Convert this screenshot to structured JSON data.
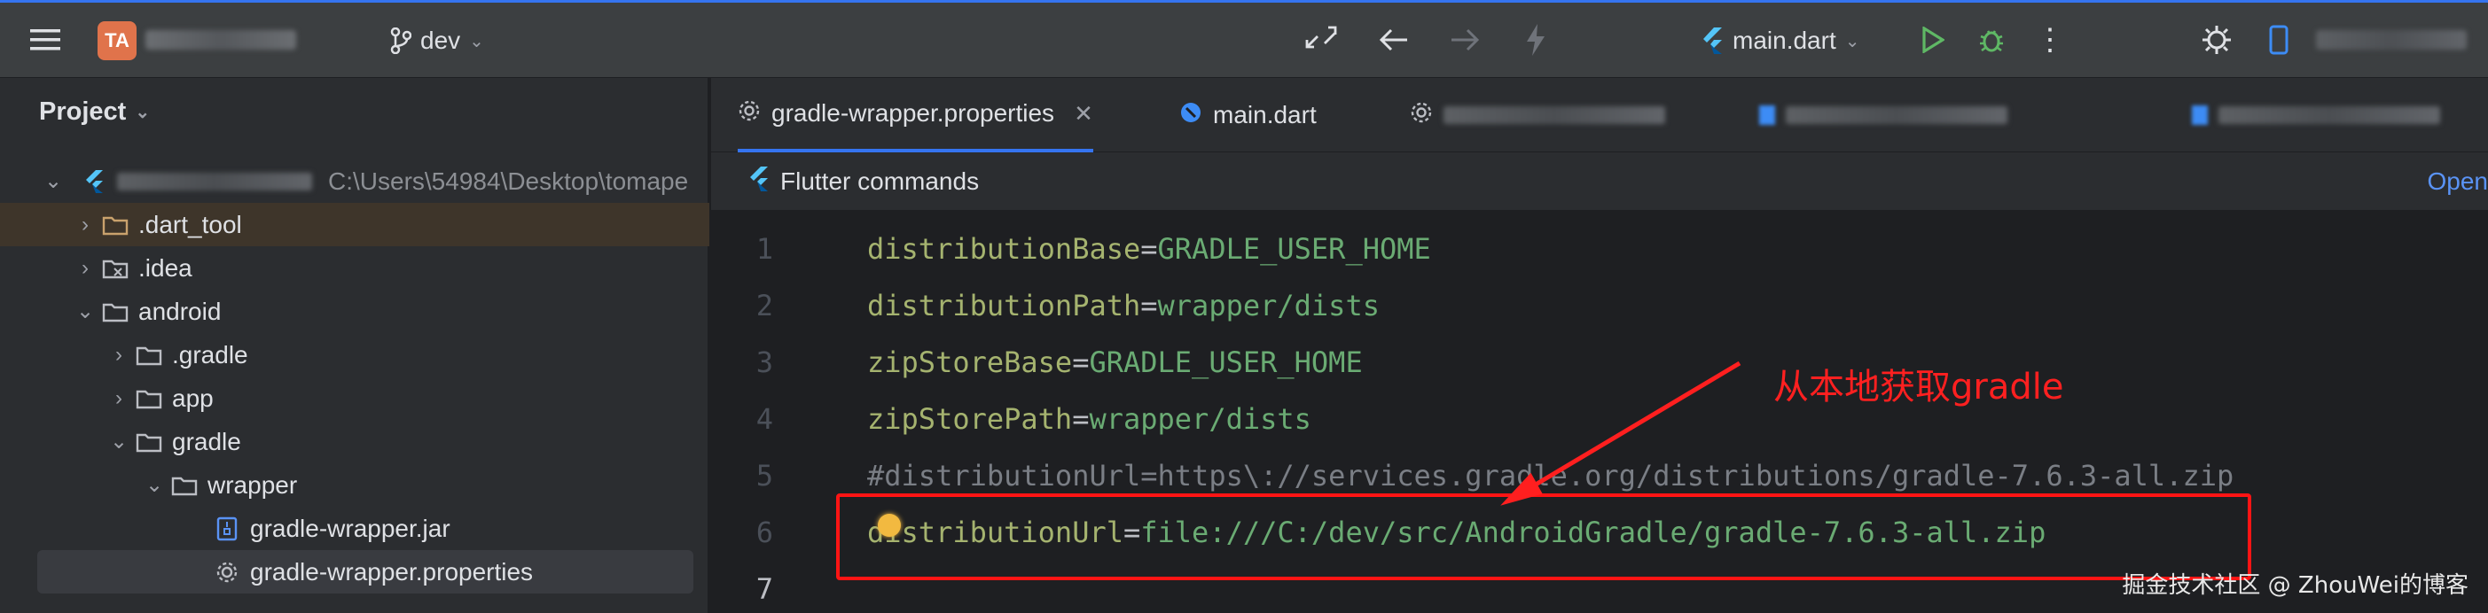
{
  "topbar": {
    "project_badge": "TA",
    "branch": "dev",
    "run_config": "main.dart"
  },
  "project_panel": {
    "title": "Project",
    "root_path": "C:\\Users\\54984\\Desktop\\tomape",
    "items": [
      {
        "label": ".dart_tool",
        "depth": 1,
        "expanded": false
      },
      {
        "label": ".idea",
        "depth": 1,
        "expanded": false
      },
      {
        "label": "android",
        "depth": 1,
        "expanded": true
      },
      {
        "label": ".gradle",
        "depth": 2,
        "expanded": false
      },
      {
        "label": "app",
        "depth": 2,
        "expanded": false
      },
      {
        "label": "gradle",
        "depth": 2,
        "expanded": true
      },
      {
        "label": "wrapper",
        "depth": 3,
        "expanded": true
      },
      {
        "label": "gradle-wrapper.jar",
        "depth": 4
      },
      {
        "label": "gradle-wrapper.properties",
        "depth": 4
      }
    ]
  },
  "editor": {
    "tabs": [
      {
        "label": "gradle-wrapper.properties"
      },
      {
        "label": "main.dart"
      }
    ],
    "notice": "Flutter commands",
    "notice_link": "Open",
    "lines": [
      {
        "num": "1",
        "key": "distributionBase",
        "value": "GRADLE_USER_HOME"
      },
      {
        "num": "2",
        "key": "distributionPath",
        "value": "wrapper/dists"
      },
      {
        "num": "3",
        "key": "zipStoreBase",
        "value": "GRADLE_USER_HOME"
      },
      {
        "num": "4",
        "key": "zipStorePath",
        "value": "wrapper/dists"
      },
      {
        "num": "5",
        "comment": "#distributionUrl=https\\://services.gradle.org/distributions/gradle-7.6.3-all.zip"
      },
      {
        "num": "6",
        "key": "distributionUrl",
        "value": "file:///C:/dev/src/AndroidGradle/gradle-7.6.3-all.zip"
      },
      {
        "num": "7"
      }
    ]
  },
  "annotation": "从本地获取gradle",
  "watermark": "掘金技术社区 @ ZhouWei的博客",
  "colors": {
    "accent": "#3574f0",
    "annotation": "#ff2020",
    "highlight_box": "#ff1414"
  }
}
